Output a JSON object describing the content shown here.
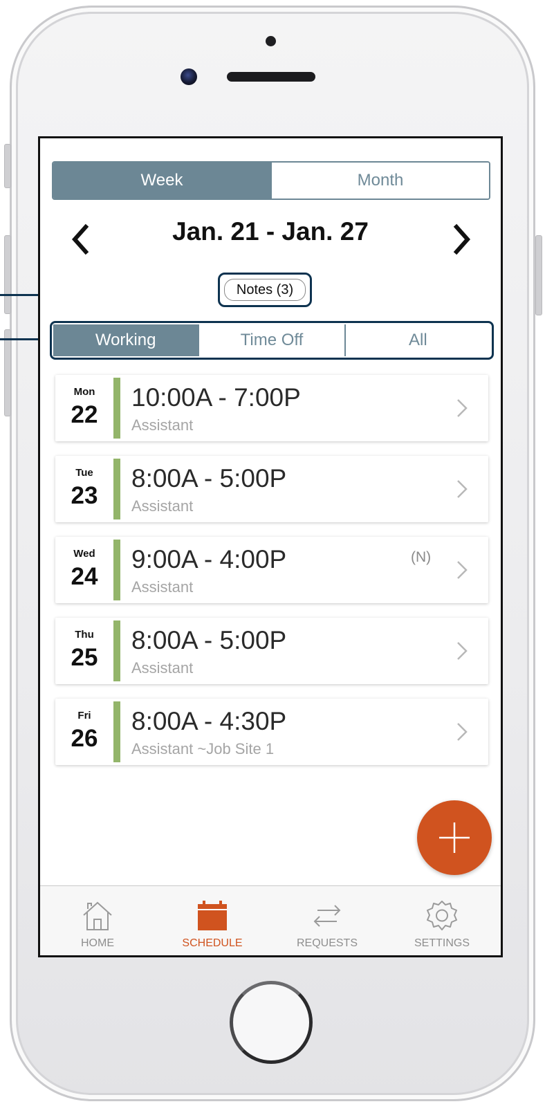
{
  "view_toggle": {
    "options": [
      "Week",
      "Month"
    ],
    "selected": 0
  },
  "date_range": "Jan. 21 - Jan. 27",
  "notes_label": "Notes (3)",
  "filter": {
    "options": [
      "Working",
      "Time Off",
      "All"
    ],
    "selected": 0
  },
  "shifts": [
    {
      "dow": "Mon",
      "day": "22",
      "time": "10:00A - 7:00P",
      "role": "Assistant",
      "note": ""
    },
    {
      "dow": "Tue",
      "day": "23",
      "time": "8:00A - 5:00P",
      "role": "Assistant",
      "note": ""
    },
    {
      "dow": "Wed",
      "day": "24",
      "time": "9:00A - 4:00P",
      "role": "Assistant",
      "note": "(N)"
    },
    {
      "dow": "Thu",
      "day": "25",
      "time": "8:00A - 5:00P",
      "role": "Assistant",
      "note": ""
    },
    {
      "dow": "Fri",
      "day": "26",
      "time": "8:00A - 4:30P",
      "role": "Assistant ~Job Site 1",
      "note": ""
    }
  ],
  "tabbar": [
    {
      "label": "HOME",
      "icon": "home-icon"
    },
    {
      "label": "SCHEDULE",
      "icon": "calendar-icon"
    },
    {
      "label": "REQUESTS",
      "icon": "swap-arrows-icon"
    },
    {
      "label": "SETTINGS",
      "icon": "gear-icon"
    }
  ],
  "active_tab": 1,
  "colors": {
    "accent": "#d0531f",
    "segment": "#6c8795",
    "shift_bar": "#93b56a",
    "callout": "#0e3350"
  }
}
